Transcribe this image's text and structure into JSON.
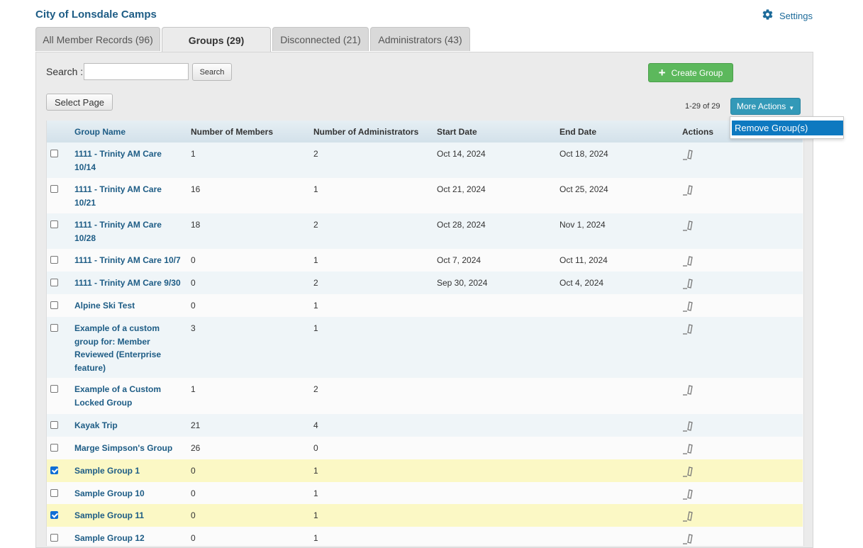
{
  "org_title": "City of Lonsdale Camps",
  "settings_label": "Settings",
  "tabs": [
    {
      "label": "All Member Records (96)"
    },
    {
      "label": "Groups (29)"
    },
    {
      "label": "Disconnected (21)"
    },
    {
      "label": "Administrators (43)"
    }
  ],
  "search": {
    "label": "Search :",
    "value": "",
    "button": "Search"
  },
  "create_group_label": "Create Group",
  "select_page_label": "Select Page",
  "range_text": "1-29 of 29",
  "more_actions_label": "More Actions",
  "more_actions_menu": [
    "Remove Group(s)"
  ],
  "columns": {
    "group_name": "Group Name",
    "members": "Number of Members",
    "admins": "Number of Administrators",
    "start": "Start Date",
    "end": "End Date",
    "actions": "Actions"
  },
  "rows": [
    {
      "name": "1111 - Trinity AM Care 10/14",
      "members": "1",
      "admins": "2",
      "start": "Oct 14, 2024",
      "end": "Oct 18, 2024",
      "checked": false
    },
    {
      "name": "1111 - Trinity AM Care 10/21",
      "members": "16",
      "admins": "1",
      "start": "Oct 21, 2024",
      "end": "Oct 25, 2024",
      "checked": false
    },
    {
      "name": "1111 - Trinity AM Care 10/28",
      "members": "18",
      "admins": "2",
      "start": "Oct 28, 2024",
      "end": "Nov 1, 2024",
      "checked": false
    },
    {
      "name": "1111 - Trinity AM Care 10/7",
      "members": "0",
      "admins": "1",
      "start": "Oct 7, 2024",
      "end": "Oct 11, 2024",
      "checked": false
    },
    {
      "name": "1111 - Trinity AM Care 9/30",
      "members": "0",
      "admins": "2",
      "start": "Sep 30, 2024",
      "end": "Oct 4, 2024",
      "checked": false
    },
    {
      "name": "Alpine Ski Test",
      "members": "0",
      "admins": "1",
      "start": "",
      "end": "",
      "checked": false
    },
    {
      "name": "Example of a custom group for: Member Reviewed (Enterprise feature)",
      "members": "3",
      "admins": "1",
      "start": "",
      "end": "",
      "checked": false
    },
    {
      "name": "Example of a Custom Locked Group",
      "members": "1",
      "admins": "2",
      "start": "",
      "end": "",
      "checked": false
    },
    {
      "name": "Kayak Trip",
      "members": "21",
      "admins": "4",
      "start": "",
      "end": "",
      "checked": false
    },
    {
      "name": "Marge Simpson's Group",
      "members": "26",
      "admins": "0",
      "start": "",
      "end": "",
      "checked": false
    },
    {
      "name": "Sample Group 1",
      "members": "0",
      "admins": "1",
      "start": "",
      "end": "",
      "checked": true
    },
    {
      "name": "Sample Group 10",
      "members": "0",
      "admins": "1",
      "start": "",
      "end": "",
      "checked": false
    },
    {
      "name": "Sample Group 11",
      "members": "0",
      "admins": "1",
      "start": "",
      "end": "",
      "checked": true
    },
    {
      "name": "Sample Group 12",
      "members": "0",
      "admins": "1",
      "start": "",
      "end": "",
      "checked": false
    }
  ]
}
